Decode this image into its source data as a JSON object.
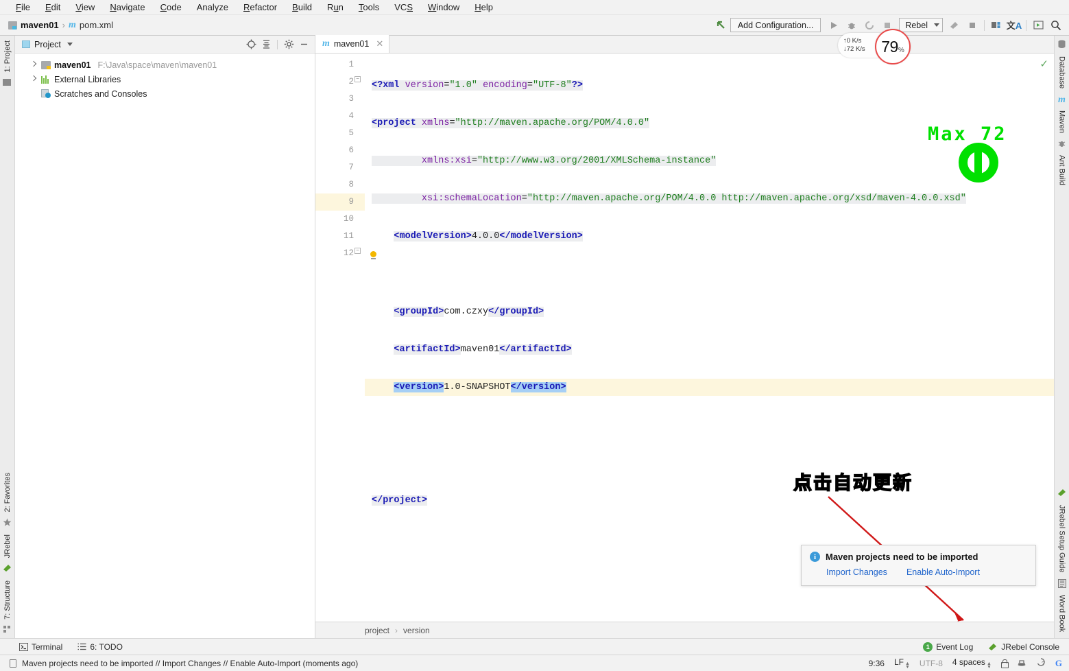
{
  "menu": {
    "items": [
      "File",
      "Edit",
      "View",
      "Navigate",
      "Code",
      "Analyze",
      "Refactor",
      "Build",
      "Run",
      "Tools",
      "VCS",
      "Window",
      "Help"
    ]
  },
  "toolbar": {
    "breadcrumb_project": "maven01",
    "breadcrumb_sep": "›",
    "breadcrumb_file": "pom.xml",
    "add_configuration": "Add Configuration...",
    "rebel_label": "Rebel",
    "net_up": "↑0  K/s",
    "net_down": "↓72 K/s",
    "gauge_value": "79",
    "gauge_unit": "%"
  },
  "left_strip": {
    "top_label": "1: Project",
    "bottom_labels": [
      "2: Favorites",
      "JRebel",
      "7: Structure"
    ]
  },
  "right_strip": {
    "top_labels": [
      "Database",
      "Maven",
      "Ant Build"
    ],
    "bottom_labels": [
      "JRebel Setup Guide",
      "Word Book"
    ]
  },
  "project_panel": {
    "title": "Project",
    "tree": [
      {
        "label": "maven01",
        "path": "F:\\Java\\space\\maven\\maven01",
        "icon": "folder-module-icon",
        "expandable": true
      },
      {
        "label": "External Libraries",
        "path": "",
        "icon": "library-icon",
        "expandable": true
      },
      {
        "label": "Scratches and Consoles",
        "path": "",
        "icon": "scratches-icon",
        "expandable": false
      }
    ]
  },
  "editor": {
    "tab_label": "maven01",
    "tab_icon": "maven-m-icon",
    "line_numbers": [
      "1",
      "2",
      "3",
      "4",
      "5",
      "6",
      "7",
      "8",
      "9",
      "10",
      "11",
      "12"
    ],
    "highlighted_line": 9,
    "breadcrumb": [
      "project",
      "version"
    ],
    "code_lines": [
      "<?xml version=\"1.0\" encoding=\"UTF-8\"?>",
      "<project xmlns=\"http://maven.apache.org/POM/4.0.0\"",
      "         xmlns:xsi=\"http://www.w3.org/2001/XMLSchema-instance\"",
      "         xsi:schemaLocation=\"http://maven.apache.org/POM/4.0.0 http://maven.apache.org/xsd/maven-4.0.0.xsd\"",
      "    <modelVersion>4.0.0</modelVersion>",
      "",
      "    <groupId>com.czxy</groupId>",
      "    <artifactId>maven01</artifactId>",
      "    <version>1.0-SNAPSHOT</version>",
      "",
      "",
      "</project>"
    ]
  },
  "annotations": {
    "chinese_note": "点击自动更新",
    "green_max_text": "Max  72",
    "green_color": "#00e000",
    "note_color": "#e81414"
  },
  "notification": {
    "title": "Maven projects need to be imported",
    "link_import": "Import Changes",
    "link_autoimport": "Enable Auto-Import"
  },
  "tool_strip": {
    "terminal": "Terminal",
    "todo": "6: TODO",
    "event_log": "Event Log",
    "event_log_count": "1",
    "jrebel_console": "JRebel Console"
  },
  "status_bar": {
    "message": "Maven projects need to be imported // Import Changes // Enable Auto-Import (moments ago)",
    "caret": "9:36",
    "line_sep": "LF",
    "encoding": "UTF-8",
    "indent": "4 spaces"
  }
}
